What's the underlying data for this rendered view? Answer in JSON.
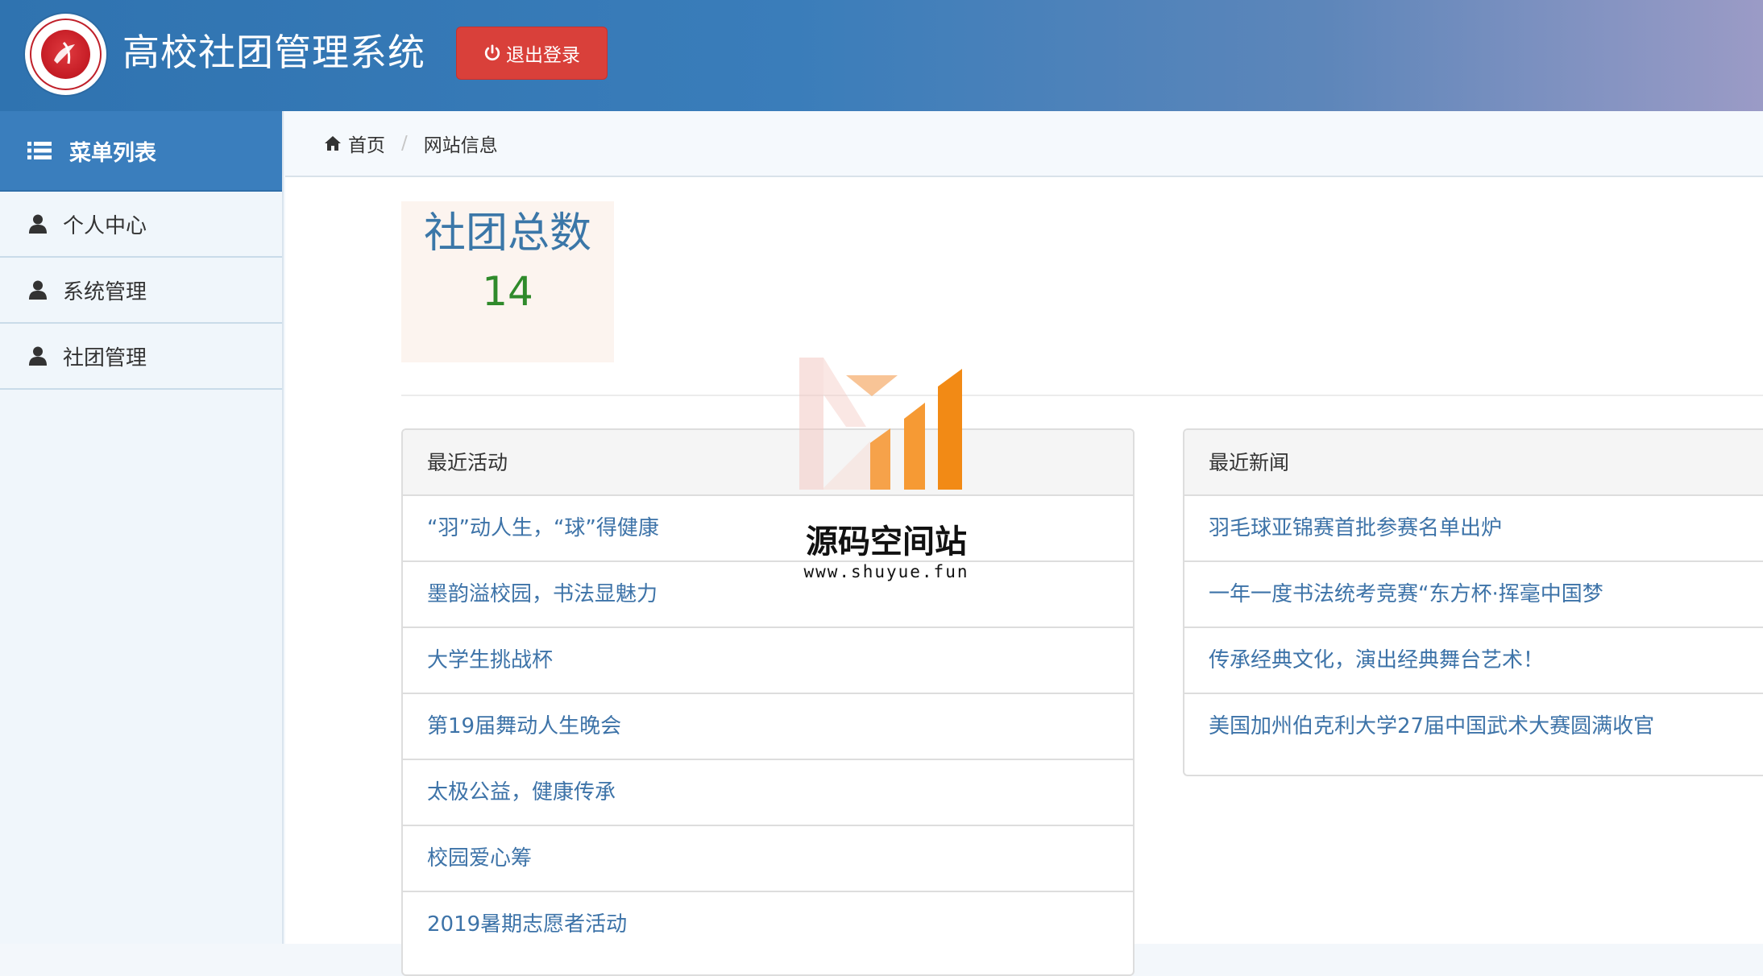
{
  "header": {
    "app_title": "高校社团管理系统",
    "logout_label": "退出登录",
    "logo_icon": "university-seal-icon",
    "logout_icon": "power-icon",
    "colors": {
      "header_start": "#2f73b0",
      "header_end": "#9b9bc6",
      "logout_bg": "#d9403a"
    }
  },
  "sidebar": {
    "title": "菜单列表",
    "title_icon": "list-icon",
    "items": [
      {
        "label": "个人中心",
        "icon": "user-icon"
      },
      {
        "label": "系统管理",
        "icon": "user-icon"
      },
      {
        "label": "社团管理",
        "icon": "user-icon"
      }
    ]
  },
  "breadcrumb": {
    "home": "首页",
    "separator": "/",
    "current": "网站信息"
  },
  "stat": {
    "label": "社团总数",
    "value": "14"
  },
  "activities": {
    "title": "最近活动",
    "items": [
      "“羽”动人生，“球”得健康",
      "墨韵溢校园，书法显魅力",
      "大学生挑战杯",
      "第19届舞动人生晚会",
      "太极公益，健康传承",
      "校园爱心筹",
      "2019暑期志愿者活动"
    ]
  },
  "news": {
    "title": "最近新闻",
    "items": [
      "羽毛球亚锦赛首批参赛名单出炉",
      "一年一度书法统考竞赛“东方杯·挥毫中国梦",
      "传承经典文化，演出经典舞台艺术！",
      "美国加州伯克利大学27届中国武术大赛圆满收官"
    ]
  },
  "watermark": {
    "title": "源码空间站",
    "url": "www.shuyue.fun"
  }
}
